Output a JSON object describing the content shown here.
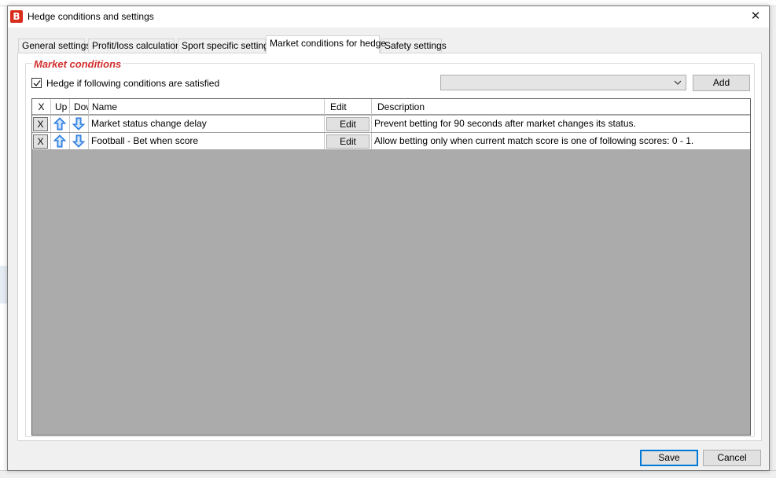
{
  "dialog": {
    "title": "Hedge conditions and settings",
    "app_icon_letter": "B",
    "close_label": "✕"
  },
  "tabs": [
    {
      "label": "General settings",
      "active": false
    },
    {
      "label": "Profit/loss calculation",
      "active": false
    },
    {
      "label": "Sport specific settings",
      "active": false
    },
    {
      "label": "Market conditions for hedge",
      "active": true
    },
    {
      "label": "Safety settings",
      "active": false
    }
  ],
  "market_conditions": {
    "group_title": "Market conditions",
    "checkbox_label": "Hedge if following conditions are satisfied",
    "checkbox_checked": true,
    "combo_value": "",
    "add_label": "Add"
  },
  "grid": {
    "columns": [
      "X",
      "Up",
      "Dow",
      "Name",
      "Edit",
      "Description"
    ],
    "rows": [
      {
        "x": "X",
        "name": "Market status change delay",
        "edit": "Edit",
        "description": "Prevent betting for 90 seconds after market changes its status."
      },
      {
        "x": "X",
        "name": "Football - Bet when score",
        "edit": "Edit",
        "description": "Allow betting only when current match score is one of following scores: 0 - 1."
      }
    ],
    "up_icon": "arrow-up-icon",
    "down_icon": "arrow-down-icon",
    "empty_area_color": "#ababab"
  },
  "footer": {
    "save_label": "Save",
    "cancel_label": "Cancel"
  },
  "colors": {
    "accent": "#0078d7",
    "group_title": "#d32f2f",
    "app_icon": "#d92d1c",
    "arrow_blue": "#1e6fd9"
  }
}
